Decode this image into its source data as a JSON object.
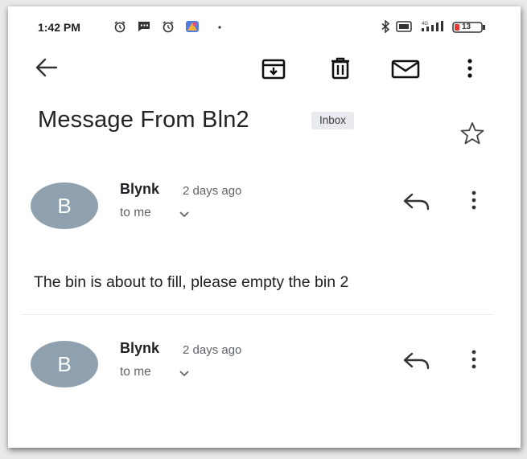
{
  "status_bar": {
    "time": "1:42 PM",
    "left_icons": [
      "alarm-icon",
      "message-icon",
      "alarm-icon",
      "app-icon",
      "dot-icon"
    ],
    "right_icons": [
      "bluetooth-icon",
      "vo-lte-icon",
      "signal-icon",
      "battery-icon"
    ],
    "battery_level": "13"
  },
  "toolbar": {
    "icons": [
      "back-arrow-icon",
      "archive-icon",
      "delete-icon",
      "mail-icon",
      "more-vert-icon"
    ]
  },
  "subject": {
    "title": "Message From Bln2",
    "label": "Inbox"
  },
  "messages": [
    {
      "avatar_letter": "B",
      "sender": "Blynk",
      "date": "2 days ago",
      "recipient": "to me",
      "body": "The bin is about to fill, please empty the bin 2"
    },
    {
      "avatar_letter": "B",
      "sender": "Blynk",
      "date": "2 days ago",
      "recipient": "to me"
    }
  ],
  "colors": {
    "avatar_bg": "#8fa1ae",
    "chip_bg": "#e8eaed",
    "battery_accent": "#e53935"
  }
}
